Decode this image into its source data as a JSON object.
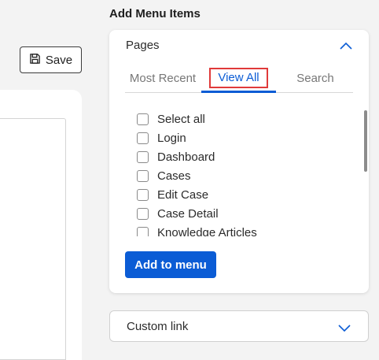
{
  "toolbar": {
    "save_label": "Save"
  },
  "panel": {
    "title": "Add Menu Items"
  },
  "pages": {
    "header": "Pages",
    "tabs": [
      "Most Recent",
      "View All",
      "Search"
    ],
    "active_tab": "View All",
    "items": [
      "Select all",
      "Login",
      "Dashboard",
      "Cases",
      "Edit Case",
      "Case Detail",
      "Knowledge Articles"
    ],
    "add_button": "Add to menu"
  },
  "custom_link": {
    "label": "Custom link"
  },
  "colors": {
    "accent": "#0b5cd5",
    "highlight_border": "#e03a3a",
    "panel_background": "#f3f3f3"
  },
  "icons": {
    "save": "floppy-disk-icon",
    "pages_toggle": "chevron-up-icon",
    "custom_link_toggle": "chevron-down-icon"
  }
}
